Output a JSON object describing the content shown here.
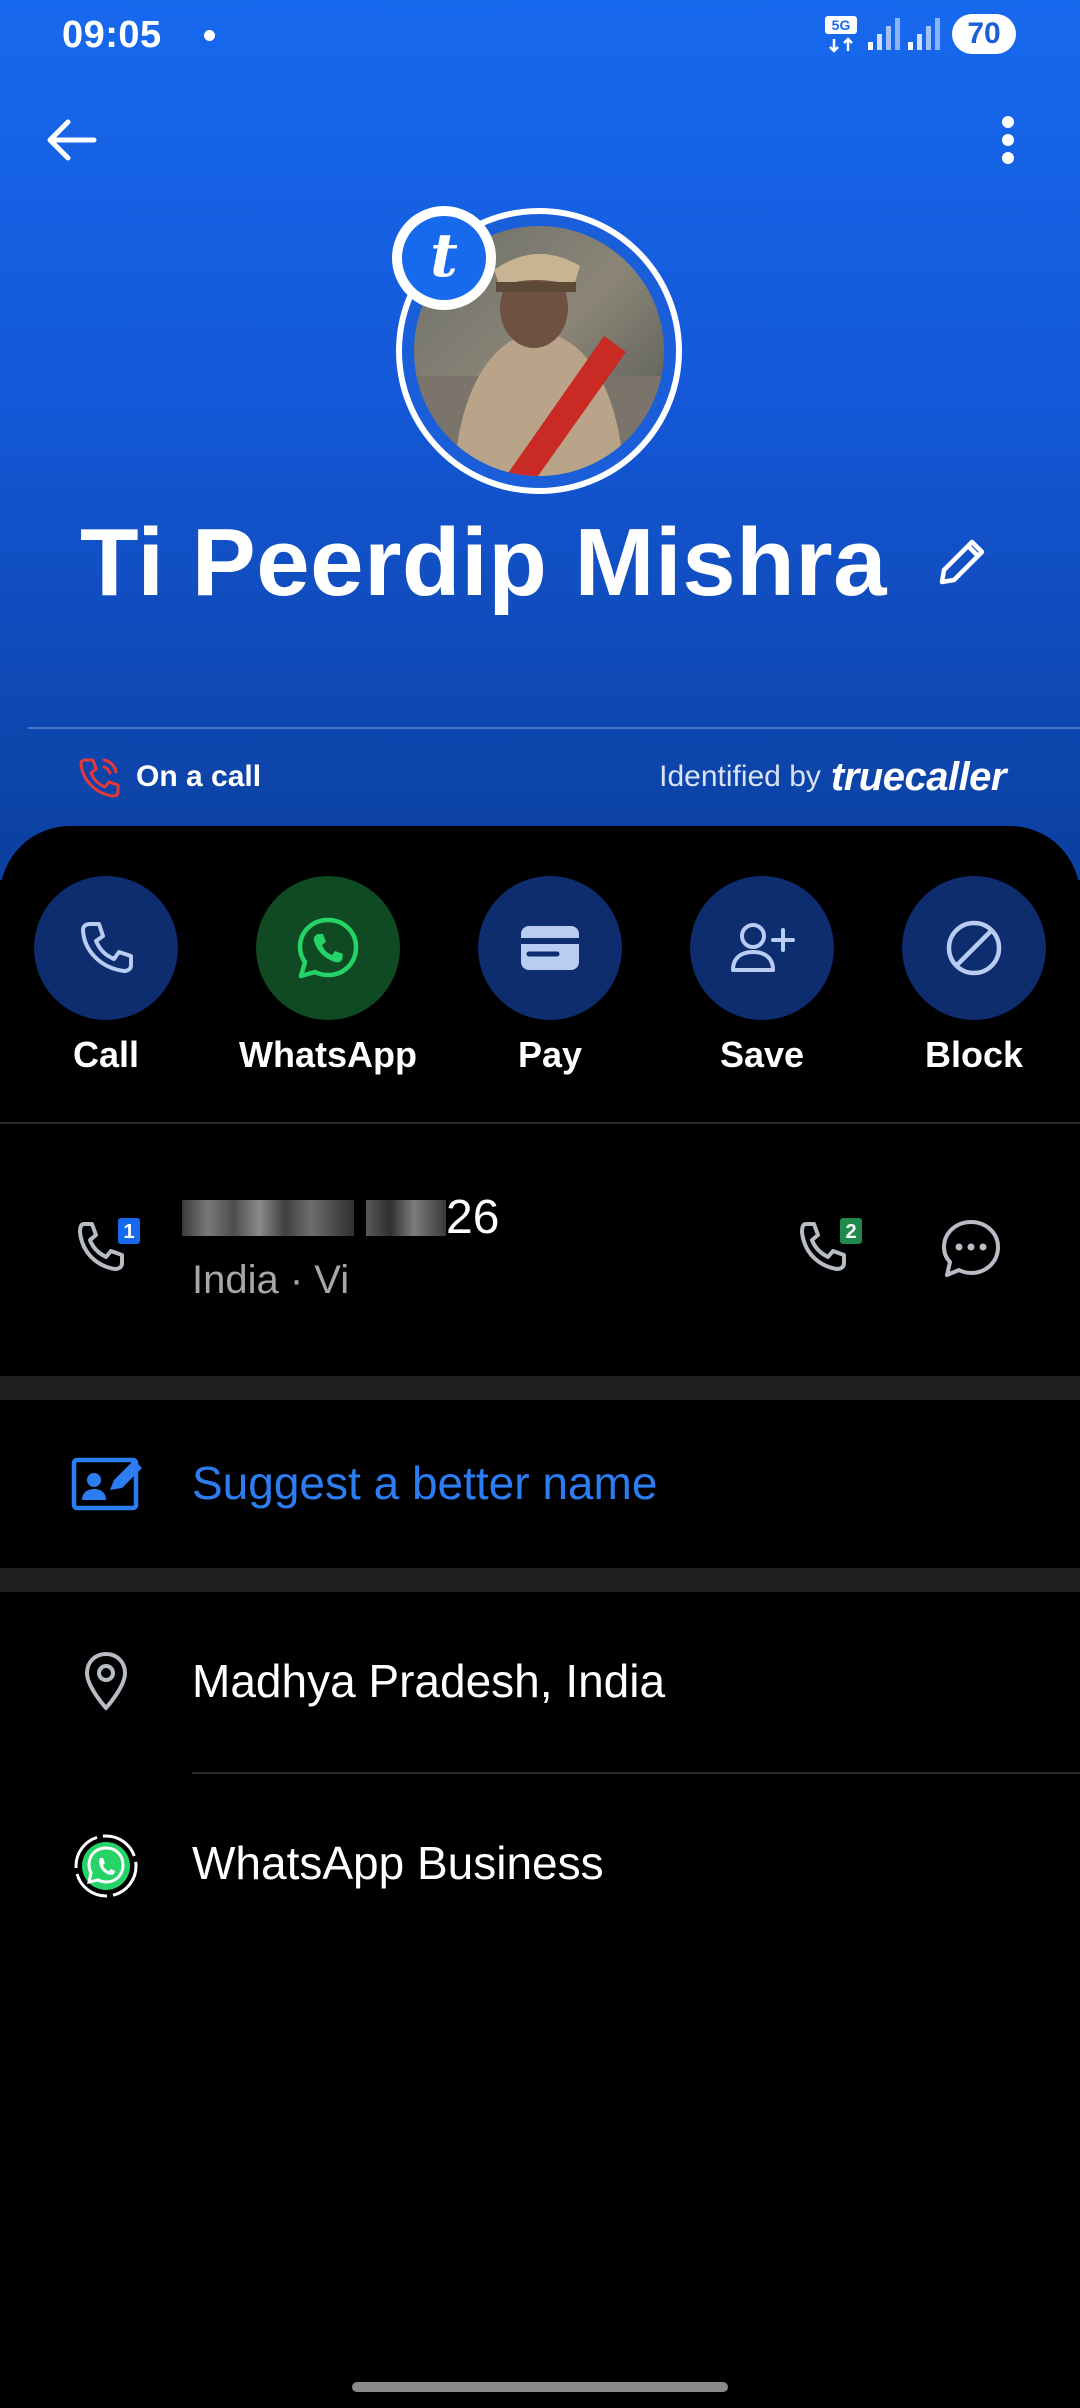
{
  "status_bar": {
    "time": "09:05",
    "network": "5G",
    "battery": "70"
  },
  "profile": {
    "name": "Ti Peerdip Mishra",
    "badge_letter": "t"
  },
  "call_state": {
    "label": "On a call"
  },
  "identified": {
    "prefix": "Identified by",
    "brand": "truecaller"
  },
  "actions": [
    {
      "label": "Call",
      "icon": "phone-icon"
    },
    {
      "label": "WhatsApp",
      "icon": "whatsapp-icon"
    },
    {
      "label": "Pay",
      "icon": "wallet-icon"
    },
    {
      "label": "Save",
      "icon": "add-person-icon"
    },
    {
      "label": "Block",
      "icon": "block-icon"
    }
  ],
  "phone": {
    "number_visible_suffix": "26",
    "sim1": "1",
    "sim2": "2",
    "carrier": "India · Vi"
  },
  "suggest": {
    "label": "Suggest a better name"
  },
  "details": {
    "location": "Madhya Pradesh, India",
    "whatsapp": "WhatsApp Business"
  },
  "colors": {
    "hero_blue": "#1769ee",
    "action_circle": "#0e2d6e",
    "whatsapp_green": "#25d366",
    "link_blue": "#2c7df2",
    "missed_red": "#e53935"
  }
}
